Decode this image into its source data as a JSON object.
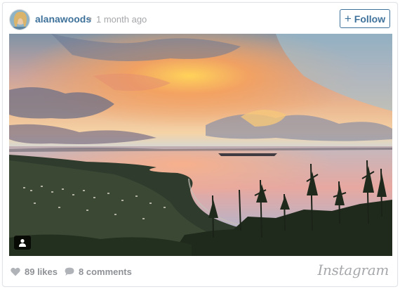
{
  "post": {
    "username": "alanawoods",
    "separator": "•",
    "time_ago": "1 month ago",
    "follow_label": "Follow",
    "follow_plus": "+",
    "likes": "89 likes",
    "comments": "8 comments",
    "brand": "Instagram"
  },
  "icons": {
    "avatar": "avatar",
    "user_tag": "user-tag-icon",
    "like": "heart-icon",
    "comment": "speech-bubble-icon"
  },
  "colors": {
    "username": "#3f729b",
    "meta_gray": "#a5a7aa",
    "footer_gray": "#8e9196"
  }
}
